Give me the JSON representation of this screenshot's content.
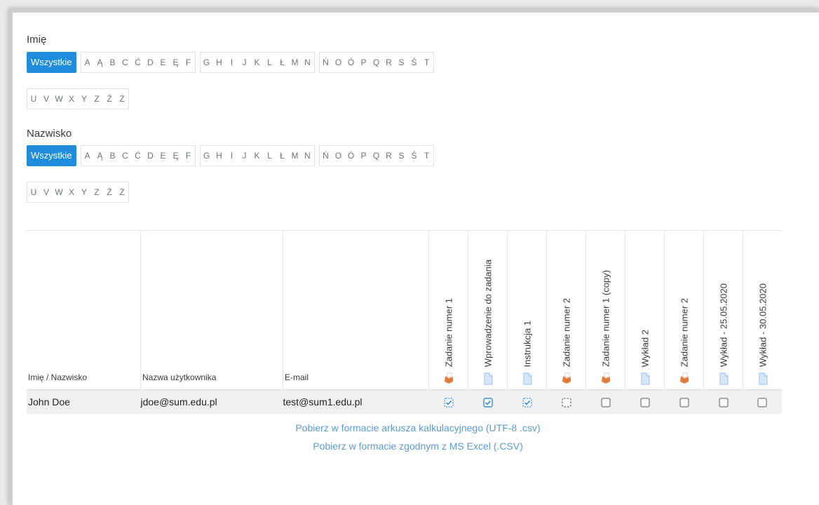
{
  "filters": [
    {
      "label": "Imię",
      "all_label": "Wszystkie",
      "groups": [
        [
          "A",
          "Ą",
          "B",
          "C",
          "Ć",
          "D",
          "E",
          "Ę",
          "F"
        ],
        [
          "G",
          "H",
          "I",
          "J",
          "K",
          "L",
          "Ł",
          "M",
          "N"
        ],
        [
          "Ń",
          "O",
          "Ó",
          "P",
          "Q",
          "R",
          "S",
          "Ś",
          "T"
        ],
        [
          "U",
          "V",
          "W",
          "X",
          "Y",
          "Z",
          "Ź",
          "Ż"
        ]
      ]
    },
    {
      "label": "Nazwisko",
      "all_label": "Wszystkie",
      "groups": [
        [
          "A",
          "Ą",
          "B",
          "C",
          "Ć",
          "D",
          "E",
          "Ę",
          "F"
        ],
        [
          "G",
          "H",
          "I",
          "J",
          "K",
          "L",
          "Ł",
          "M",
          "N"
        ],
        [
          "Ń",
          "O",
          "Ó",
          "P",
          "Q",
          "R",
          "S",
          "Ś",
          "T"
        ],
        [
          "U",
          "V",
          "W",
          "X",
          "Y",
          "Z",
          "Ź",
          "Ż"
        ]
      ]
    }
  ],
  "table": {
    "headers": {
      "name": "Imię / Nazwisko",
      "username": "Nazwa użytkownika",
      "email": "E-mail"
    },
    "activities": [
      {
        "label": "Zadanie numer 1",
        "icon": "assignment-icon"
      },
      {
        "label": "Wprowadzenie do zadania",
        "icon": "file-icon"
      },
      {
        "label": "Instrukcja 1",
        "icon": "file-icon"
      },
      {
        "label": "Zadanie numer 2",
        "icon": "assignment-icon"
      },
      {
        "label": "Zadanie numer 1 (copy)",
        "icon": "assignment-icon"
      },
      {
        "label": "Wykład 2",
        "icon": "file-icon"
      },
      {
        "label": "Zadanie numer 2",
        "icon": "assignment-icon"
      },
      {
        "label": "Wykład - 25.05.2020",
        "icon": "file-icon"
      },
      {
        "label": "Wykład - 30.05.2020",
        "icon": "file-icon"
      }
    ],
    "rows": [
      {
        "name": "John Doe",
        "username": "jdoe@sum.edu.pl",
        "email": "test@sum1.edu.pl",
        "completion": [
          "auto-complete",
          "complete",
          "auto-complete",
          "auto-incomplete",
          "incomplete",
          "incomplete",
          "incomplete",
          "incomplete",
          "incomplete"
        ]
      }
    ]
  },
  "downloads": {
    "csv_utf8": "Pobierz w formacie arkusza kalkulacyjnego (UTF-8 .csv)",
    "csv_excel": "Pobierz w formacie zgodnym z MS Excel (.CSV)"
  },
  "colors": {
    "accent": "#1f8ddc",
    "link": "#5b9bd5",
    "check": "#3a8fd8"
  }
}
